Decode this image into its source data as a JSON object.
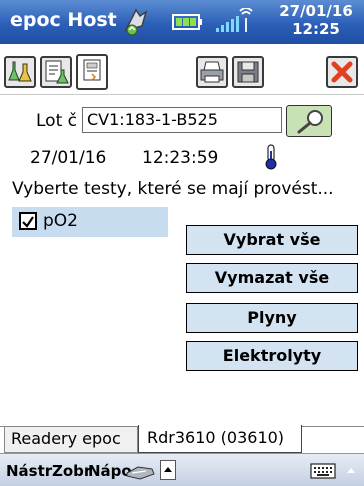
{
  "titlebar": {
    "app_title": "epoc Host",
    "date": "27/01/16",
    "time": "12:25"
  },
  "toolbar": {
    "buttons": [
      "flasks-icon",
      "document-flask-icon",
      "barcode-card-icon",
      "printer-icon",
      "save-disk-icon",
      "close-x-icon"
    ]
  },
  "lot": {
    "label": "Lot č",
    "value": "CV1:183-1-B525"
  },
  "status": {
    "date": "27/01/16",
    "time": "12:23:59"
  },
  "instruction": "Vyberte testy, které se mají provést...",
  "tests": [
    {
      "label": "pO2",
      "checked": true
    }
  ],
  "actions": {
    "select_all": "Vybrat vše",
    "clear_all": "Vymazat vše",
    "gases": "Plyny",
    "electrolytes": "Elektrolyty"
  },
  "tabs": {
    "readers": "Readery epoc",
    "reader": "Rdr3610 (03610)"
  },
  "menu": {
    "tools": "Nástr",
    "view": "Zobr",
    "help": "Nápo"
  },
  "colors": {
    "titlebar": "#2c5fb8",
    "list_selection": "#c7dcef",
    "button_bg": "#d4e3f1",
    "close_red": "#e04020"
  }
}
